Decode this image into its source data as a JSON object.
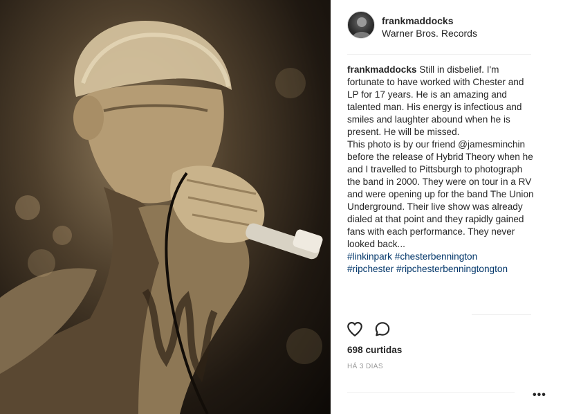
{
  "post": {
    "username": "frankmaddocks",
    "location": "Warner Bros. Records",
    "caption": {
      "username": "frankmaddocks",
      "text": " Still in disbelief. I'm fortunate to have worked with Chester and LP for 17 years. He is an amazing and talented man. His energy is infectious and smiles and laughter abound when he is present. He will be missed.\nThis photo is by our friend @jamesminchin before the release of Hybrid Theory when he and I travelled to Pittsburgh to photograph the band in 2000. They were on tour in a RV and were opening up for the band The Union Underground. Their live show was already dialed at that point and they rapidly gained fans with each performance. They never looked back...\n",
      "hashtags_line1": "#linkinpark #chesterbennington",
      "hashtags_line2": "#ripchester #ripchesterbenningtongton"
    },
    "likes": "698 curtidas",
    "time": "HÁ 3 DIAS",
    "more_label": "•••"
  },
  "icons": {
    "like": "heart-icon",
    "comment": "comment-bubble-icon",
    "options": "more-options-icon"
  },
  "colors": {
    "text": "#262626",
    "hashtag": "#003569",
    "muted": "#999999",
    "divider": "#efefef"
  }
}
